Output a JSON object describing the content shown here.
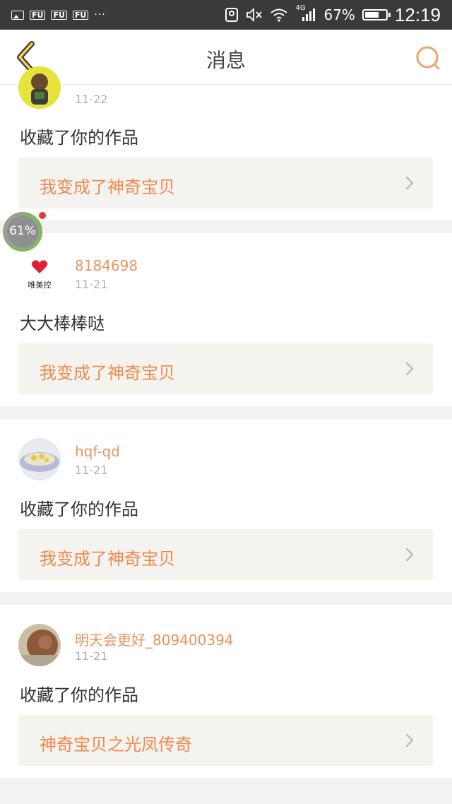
{
  "status_bar": {
    "notification_tags": [
      "FU",
      "FU",
      "FU"
    ],
    "more": "···",
    "network": "4G",
    "battery_percent": "67%",
    "battery_level": 0.67,
    "time": "12:19"
  },
  "header": {
    "title": "消息",
    "back_icon": "chevron-left-icon",
    "search_icon": "search-icon",
    "accent_color": "#e8935a"
  },
  "progress_ball": {
    "label": "61%",
    "value": 0.61
  },
  "messages": [
    {
      "username": "",
      "date": "11-22",
      "text": "收藏了你的作品",
      "work_title": "我变成了神奇宝贝"
    },
    {
      "username": "8184698",
      "avatar_label": "唯美控",
      "date": "11-21",
      "text": "大大棒棒哒",
      "work_title": "我变成了神奇宝贝"
    },
    {
      "username": "hqf-qd",
      "date": "11-21",
      "text": "收藏了你的作品",
      "work_title": "我变成了神奇宝贝"
    },
    {
      "username": "明天会更好_809400394",
      "date": "11-21",
      "text": "收藏了你的作品",
      "work_title": "神奇宝贝之光凤传奇"
    }
  ]
}
